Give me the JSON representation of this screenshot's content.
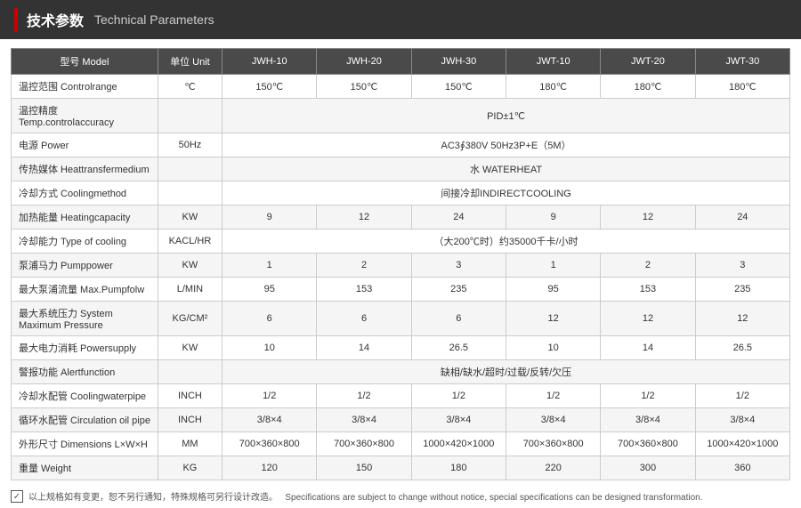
{
  "header": {
    "accent_color": "#c00",
    "zh_title": "技术参数",
    "en_title": "Technical Parameters"
  },
  "table": {
    "columns": [
      {
        "id": "model",
        "zh": "型号",
        "en": "Model"
      },
      {
        "id": "unit",
        "zh": "单位",
        "en": "Unit"
      },
      {
        "id": "jwh10",
        "label": "JWH-10"
      },
      {
        "id": "jwh20",
        "label": "JWH-20"
      },
      {
        "id": "jwh30",
        "label": "JWH-30"
      },
      {
        "id": "jwt10",
        "label": "JWT-10"
      },
      {
        "id": "jwt20",
        "label": "JWT-20"
      },
      {
        "id": "jwt30",
        "label": "JWT-30"
      }
    ],
    "rows": [
      {
        "label_zh": "温控范围",
        "label_en": "Controlrange",
        "unit": "℃",
        "jwh10": "150℃",
        "jwh20": "150℃",
        "jwh30": "150℃",
        "jwt10": "180℃",
        "jwt20": "180℃",
        "jwt30": "180℃",
        "merged": false
      },
      {
        "label_zh": "温控精度",
        "label_en": "Temp.controlaccuracy",
        "unit": "",
        "merged": true,
        "merged_text": "PID±1℃"
      },
      {
        "label_zh": "电源",
        "label_en": "Power",
        "unit": "50Hz",
        "merged": true,
        "merged_text": "AC3∮380V 50Hz3P+E（5M）"
      },
      {
        "label_zh": "传热媒体",
        "label_en": "Heattransfermedium",
        "unit": "",
        "merged": true,
        "merged_text": "水 WATERHEAT"
      },
      {
        "label_zh": "冷却方式",
        "label_en": "Coolingmethod",
        "unit": "",
        "merged": true,
        "merged_text": "间接冷却INDIRECTCOOLING"
      },
      {
        "label_zh": "加热能量",
        "label_en": "Heatingcapacity",
        "unit": "KW",
        "jwh10": "9",
        "jwh20": "12",
        "jwh30": "24",
        "jwt10": "9",
        "jwt20": "12",
        "jwt30": "24",
        "merged": false
      },
      {
        "label_zh": "冷却能力",
        "label_en": "Type of cooling",
        "unit": "KACL/HR",
        "merged": true,
        "merged_text": "（大200℃时）约35000千卡/小时"
      },
      {
        "label_zh": "泵浦马力",
        "label_en": "Pumppower",
        "unit": "KW",
        "jwh10": "1",
        "jwh20": "2",
        "jwh30": "3",
        "jwt10": "1",
        "jwt20": "2",
        "jwt30": "3",
        "merged": false
      },
      {
        "label_zh": "最大泵浦流量",
        "label_en": "Max.Pumpfolw",
        "unit": "L/MIN",
        "jwh10": "95",
        "jwh20": "153",
        "jwh30": "235",
        "jwt10": "95",
        "jwt20": "153",
        "jwt30": "235",
        "merged": false
      },
      {
        "label_zh": "最大系统压力",
        "label_en": "System Maximum Pressure",
        "unit": "KG/CM²",
        "jwh10": "6",
        "jwh20": "6",
        "jwh30": "6",
        "jwt10": "12",
        "jwt20": "12",
        "jwt30": "12",
        "merged": false
      },
      {
        "label_zh": "最大电力消耗",
        "label_en": "Powersupply",
        "unit": "KW",
        "jwh10": "10",
        "jwh20": "14",
        "jwh30": "26.5",
        "jwt10": "10",
        "jwt20": "14",
        "jwt30": "26.5",
        "merged": false
      },
      {
        "label_zh": "警报功能",
        "label_en": "Alertfunction",
        "unit": "",
        "merged": true,
        "merged_text": "缺相/缺水/超时/过载/反转/欠压"
      },
      {
        "label_zh": "冷却水配管",
        "label_en": "Coolingwaterpipe",
        "unit": "INCH",
        "jwh10": "1/2",
        "jwh20": "1/2",
        "jwh30": "1/2",
        "jwt10": "1/2",
        "jwt20": "1/2",
        "jwt30": "1/2",
        "merged": false
      },
      {
        "label_zh": "循环水配管",
        "label_en": "Circulation oil pipe",
        "unit": "INCH",
        "jwh10": "3/8×4",
        "jwh20": "3/8×4",
        "jwh30": "3/8×4",
        "jwt10": "3/8×4",
        "jwt20": "3/8×4",
        "jwt30": "3/8×4",
        "merged": false
      },
      {
        "label_zh": "外形尺寸",
        "label_en": "Dimensions L×W×H",
        "unit": "MM",
        "jwh10": "700×360×800",
        "jwh20": "700×360×800",
        "jwh30": "1000×420×1000",
        "jwt10": "700×360×800",
        "jwt20": "700×360×800",
        "jwt30": "1000×420×1000",
        "merged": false
      },
      {
        "label_zh": "重量",
        "label_en": "Weight",
        "unit": "KG",
        "jwh10": "120",
        "jwh20": "150",
        "jwh30": "180",
        "jwt10": "220",
        "jwt20": "300",
        "jwt30": "360",
        "merged": false
      }
    ]
  },
  "footer": {
    "icon": "✓",
    "zh_text": "以上规格如有变更，恕不另行通知，特殊规格可另行设计改造。",
    "en_text": "Specifications are subject to change without notice, special specifications can be designed transformation."
  }
}
